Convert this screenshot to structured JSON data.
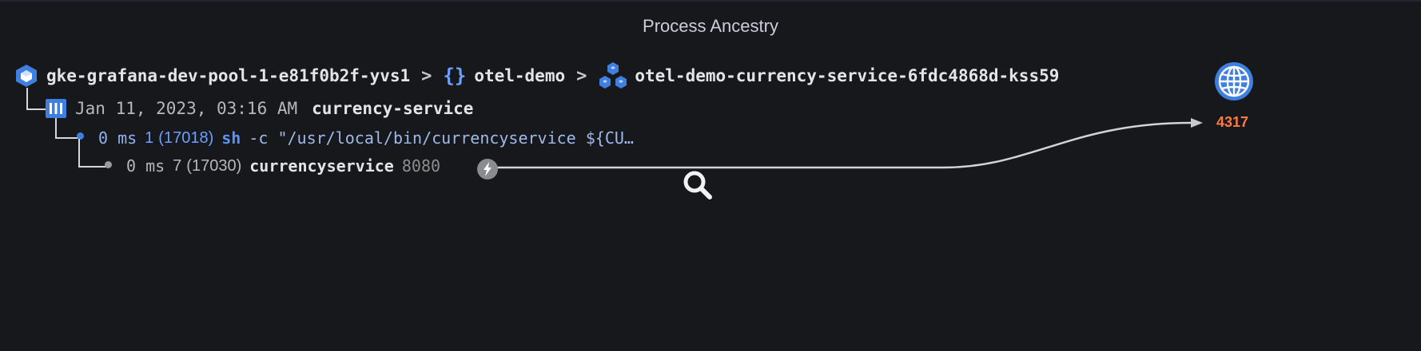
{
  "panel": {
    "title": "Process Ancestry"
  },
  "breadcrumb": {
    "node": "gke-grafana-dev-pool-1-e81f0b2f-yvs1",
    "namespace_glyph": "{}",
    "namespace": "otel-demo",
    "pod": "otel-demo-currency-service-6fdc4868d-kss59",
    "separator": ">"
  },
  "container": {
    "timestamp": "Jan 11, 2023, 03:16 AM",
    "name": "currency-service"
  },
  "processes": [
    {
      "time": "0 ms",
      "pid": "1",
      "host_pid": "(17018)",
      "command": "sh",
      "args": "-c \"/usr/local/bin/currencyservice ${CU…"
    },
    {
      "time": "0 ms",
      "pid": "7",
      "host_pid": "(17030)",
      "command": "currencyservice",
      "port": "8080"
    }
  ],
  "connection": {
    "remote_port": "4317"
  },
  "colors": {
    "accent_blue": "#3f7fe0",
    "port_orange": "#ff7a45",
    "background": "#17181c"
  },
  "icons": {
    "node": "cube-icon",
    "namespace": "braces-icon",
    "pod": "cubes-icon",
    "container": "container-icon",
    "port": "bolt-icon",
    "remote": "globe-icon",
    "search": "search-icon"
  }
}
